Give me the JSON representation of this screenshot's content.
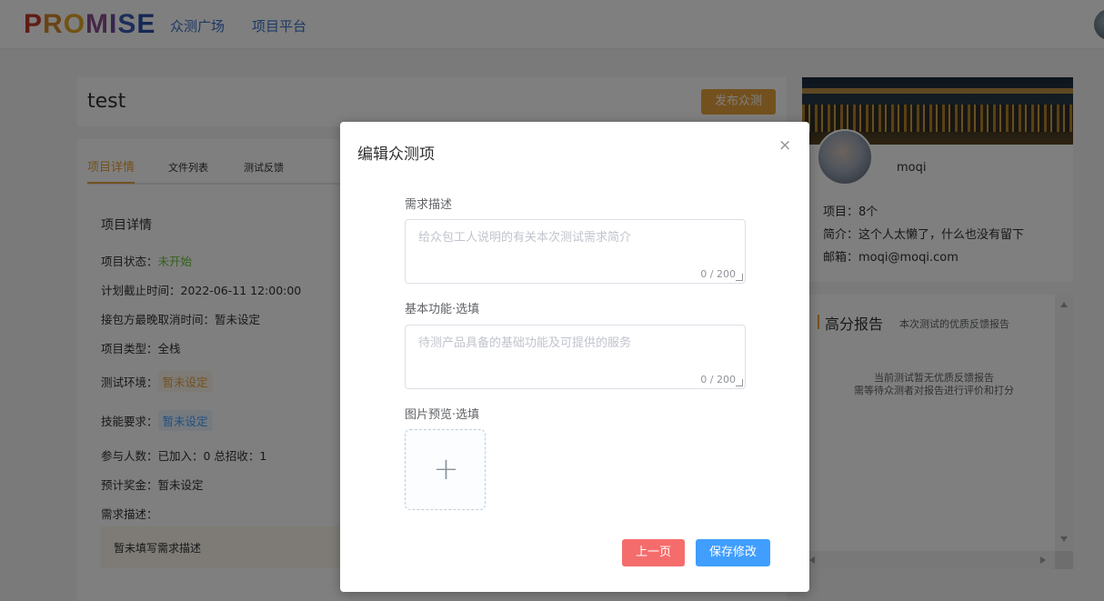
{
  "header": {
    "logo_letters": [
      {
        "char": "P",
        "color": "#c0392b"
      },
      {
        "char": "R",
        "color": "#d4882a"
      },
      {
        "char": "O",
        "color": "#e4a726"
      },
      {
        "char": "M",
        "color": "#8a4f8f"
      },
      {
        "char": "I",
        "color": "#6c4c9a"
      },
      {
        "char": "S",
        "color": "#3a5cb0"
      },
      {
        "char": "E",
        "color": "#2b4fa8"
      }
    ],
    "nav": [
      "众测广场",
      "项目平台"
    ]
  },
  "project": {
    "title": "test",
    "publish_button": "发布众测",
    "tabs": [
      "项目详情",
      "文件列表",
      "测试反馈"
    ],
    "section_title": "项目详情",
    "status_label": "项目状态：",
    "status_value": "未开始",
    "deadline": "计划截止时间：2022-06-11 12:00:00",
    "cancel_time": "接包方最晚取消时间：暂未设定",
    "type": "项目类型：全栈",
    "env_label": "测试环境：",
    "env_value": "暂未设定",
    "skill_label": "技能要求：",
    "skill_value": "暂未设定",
    "participants": "参与人数：已加入：0   总招收：1",
    "bonus": "预计奖金：暂未设定",
    "desc_label": "需求描述：",
    "desc_value": "暂未填写需求描述"
  },
  "profile": {
    "name": "moqi",
    "projects": "项目：8个",
    "bio": "简介：这个人太懒了，什么也没有留下",
    "email": "邮箱：moqi@moqi.com"
  },
  "report": {
    "title": "高分报告",
    "subtitle": "本次测试的优质反馈报告",
    "empty_line1": "当前测试暂无优质反馈报告",
    "empty_line2": "需等待众测者对报告进行评价和打分"
  },
  "modal": {
    "title": "编辑众测项",
    "close_icon": "×",
    "field1_label": "需求描述",
    "field1_placeholder": "给众包工人说明的有关本次测试需求简介",
    "field1_count": "0 / 200",
    "field2_label": "基本功能·选填",
    "field2_placeholder": "待测产品具备的基础功能及可提供的服务",
    "field2_count": "0 / 200",
    "field3_label": "图片预览·选填",
    "upload_icon": "+",
    "prev_button": "上一页",
    "save_button": "保存修改"
  }
}
